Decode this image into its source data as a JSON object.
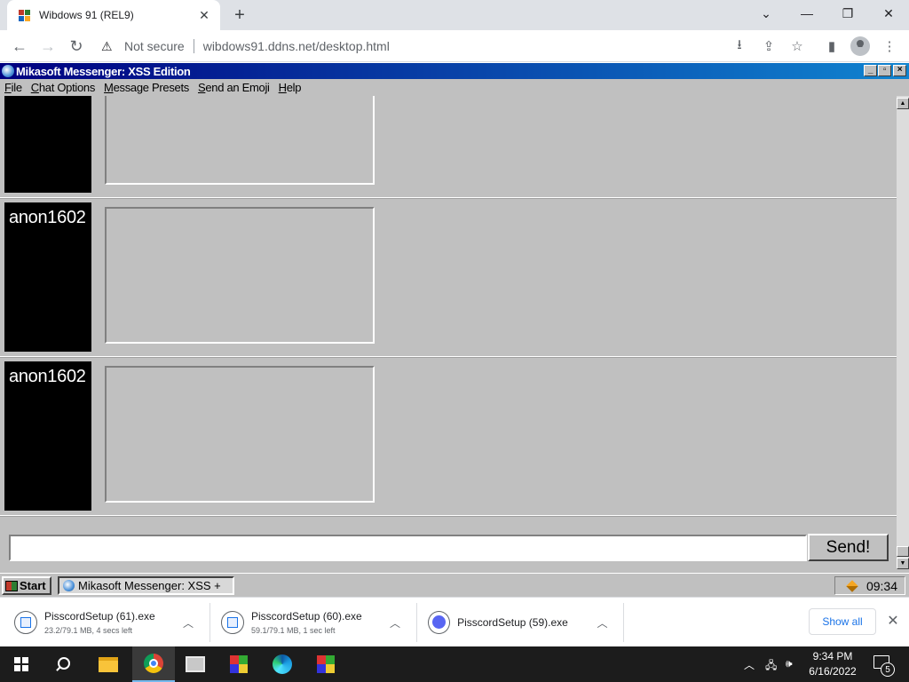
{
  "browser": {
    "tab_title": "Wibdows 91 (REL9)",
    "tab_close": "✕",
    "new_tab": "+",
    "security_label": "Not secure",
    "url": "wibdows91.ddns.net/desktop.html"
  },
  "app": {
    "title": "Mikasoft Messenger: XSS Edition",
    "menu": [
      {
        "label": "File",
        "accel": "F",
        "rest": "ile"
      },
      {
        "label": "Chat Options",
        "accel": "C",
        "rest": "hat Options"
      },
      {
        "label": "Message Presets",
        "accel": "M",
        "rest": "essage Presets"
      },
      {
        "label": "Send an Emoji",
        "accel": "S",
        "rest": "end an Emoji"
      },
      {
        "label": "Help",
        "accel": "H",
        "rest": "elp"
      }
    ],
    "messages": [
      {
        "user": "",
        "text": ""
      },
      {
        "user": "anon1602",
        "text": ""
      },
      {
        "user": "anon1602",
        "text": ""
      }
    ],
    "input_value": "",
    "send_label": "Send!"
  },
  "retro_taskbar": {
    "start_label": "Start",
    "task_label": "Mikasoft Messenger: XSS +",
    "clock": "09:34"
  },
  "downloads": {
    "items": [
      {
        "name": "PisscordSetup (61).exe",
        "status": "23.2/79.1 MB, 4 secs left",
        "icon": "file-icon"
      },
      {
        "name": "PisscordSetup (60).exe",
        "status": "59.1/79.1 MB, 1 sec left",
        "icon": "file-icon"
      },
      {
        "name": "PisscordSetup (59).exe",
        "status": "",
        "icon": "discord-icon"
      }
    ],
    "show_all": "Show all"
  },
  "windows_taskbar": {
    "time": "9:34 PM",
    "date": "6/16/2022",
    "notification_count": "5"
  }
}
